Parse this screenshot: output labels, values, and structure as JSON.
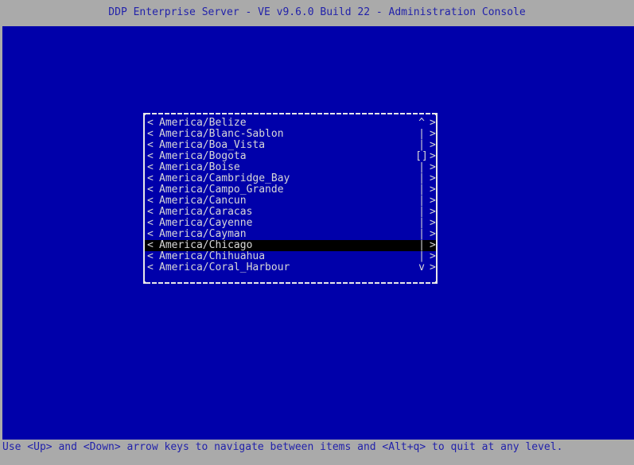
{
  "window": {
    "title": "DDP Enterprise Server - VE v9.6.0 Build 22 - Administration Console",
    "background_color": "#0000aa",
    "bar_color": "#aaaaaa",
    "bar_text_color": "#2222aa",
    "text_color": "#d8d8d8",
    "selection_color": "#000000"
  },
  "list": {
    "left_marker": "<",
    "right_marker": ">",
    "scroll_up_char": "^",
    "scroll_down_char": "v",
    "scroll_track_char": "|",
    "scroll_thumb_char": "[]",
    "selected_index": 11,
    "items": [
      {
        "label": "America/Belize",
        "scroll": "^",
        "selected": false
      },
      {
        "label": "America/Blanc-Sablon",
        "scroll": "|",
        "selected": false
      },
      {
        "label": "America/Boa_Vista",
        "scroll": "|",
        "selected": false
      },
      {
        "label": "America/Bogota",
        "scroll": "[]",
        "selected": false
      },
      {
        "label": "America/Boise",
        "scroll": "|",
        "selected": false
      },
      {
        "label": "America/Cambridge_Bay",
        "scroll": "|",
        "selected": false
      },
      {
        "label": "America/Campo_Grande",
        "scroll": "|",
        "selected": false
      },
      {
        "label": "America/Cancun",
        "scroll": "|",
        "selected": false
      },
      {
        "label": "America/Caracas",
        "scroll": "|",
        "selected": false
      },
      {
        "label": "America/Cayenne",
        "scroll": "|",
        "selected": false
      },
      {
        "label": "America/Cayman",
        "scroll": "|",
        "selected": false
      },
      {
        "label": "America/Chicago",
        "scroll": "|",
        "selected": true
      },
      {
        "label": "America/Chihuahua",
        "scroll": "|",
        "selected": false
      },
      {
        "label": "America/Coral_Harbour",
        "scroll": "v",
        "selected": false
      }
    ]
  },
  "status": {
    "hint": "Use <Up> and <Down> arrow keys to navigate between items and <Alt+q> to quit at any level."
  }
}
